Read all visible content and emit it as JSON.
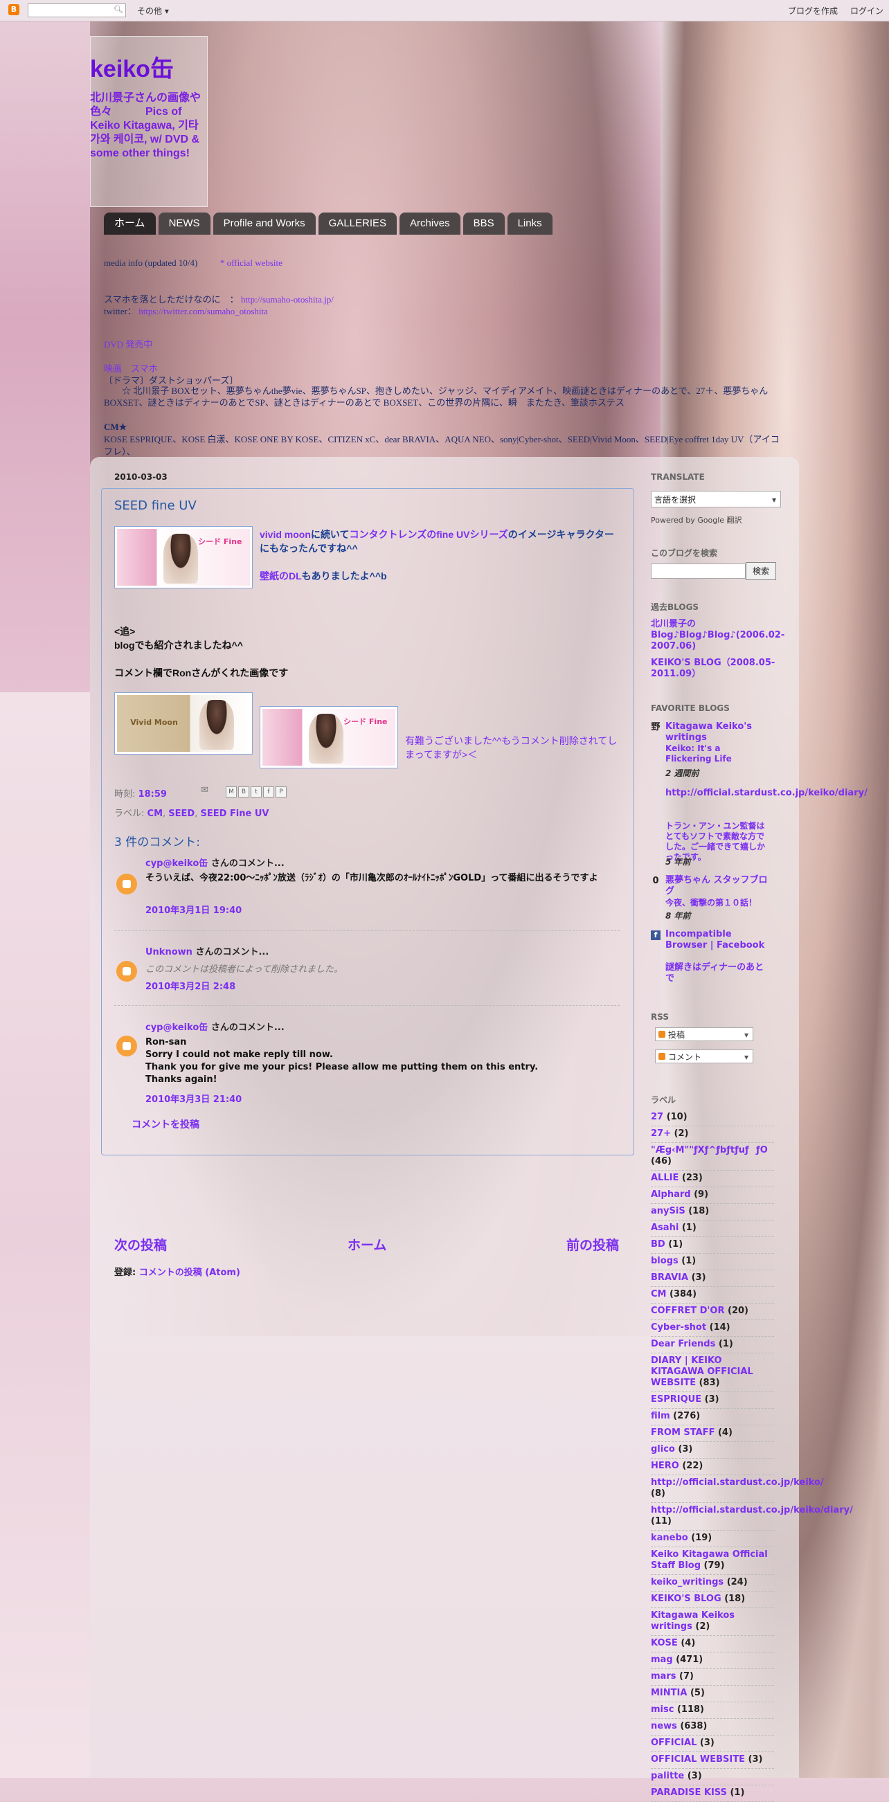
{
  "navbar": {
    "more": "その他",
    "create_blog": "ブログを作成",
    "login": "ログイン"
  },
  "header": {
    "title": "keiko缶",
    "description": "北川景子さんの画像や色々　　　Pics of Keiko Kitagawa, 기타가와 케이코, w/ DVD & some other things!"
  },
  "tabs": [
    {
      "label": "ホーム"
    },
    {
      "label": "NEWS"
    },
    {
      "label": "Profile and Works"
    },
    {
      "label": "GALLERIES"
    },
    {
      "label": "Archives"
    },
    {
      "label": "BBS"
    },
    {
      "label": "Links"
    }
  ],
  "header_links": {
    "line1": "media info (updated 10/4)",
    "official": "* official website",
    "line2_label": "スマホを落としただけなのに　：",
    "line2_url": "http://sumaho-otoshita.jp/",
    "line3_label": "twitter：",
    "line3_url": "https://twitter.com/sumaho_otoshita",
    "line4": "DVD 発売中",
    "line5": "映画　スマホ",
    "line6": "〔ドラマ〕ダストショッパーズ〕",
    "line7": "　　☆ 北川景子 BOXセット、悪夢ちゃんthe夢vie、悪夢ちゃんSP、抱きしめたい、ジャッジ、マイディアメイト、映画謎ときはディナーのあとで、27＋、悪夢ちゃん BOXSET、謎ときはディナーのあとでSP、謎ときはディナーのあとで BOXSET、この世界の片隅に、瞬　またたき、筆談ホステス",
    "cm_head": "CM★",
    "cm_list": "KOSE ESPRIQUE、KOSE 白漾、KOSE ONE BY KOSE、CITIZEN xC、dear BRAVIA、AQUA NEO、sony|Cyber-shot、SEED|Vivid Moon、SEED|Eye coffret 1day UV（アイコフレ）、"
  },
  "post": {
    "date": "2010-03-03",
    "title": "SEED fine UV",
    "p1_link1": "vivid moon",
    "p1_mid": "に続いて",
    "p1_link2": "コンタクトレンズのfine UVシリーズ",
    "p1_tail": "のイメージキャラクターにもなったんですね^^",
    "p1_link3": "壁紙のDL",
    "p1_tail2": "もありましたよ^^b",
    "p2a": "<追>",
    "p2b": "blogでも紹介されましたね^^",
    "p3": "コメント欄でRonさんがくれた画像です",
    "thanks": "有難うございました^^もうコメント削除されてしまってますが>＜",
    "thumb_label": "シード Fine",
    "thumb2_label": "Vivid Moon",
    "time_label": "時刻:",
    "time": "18:59",
    "labels_label": "ラベル:",
    "labels": [
      "CM",
      "SEED",
      "SEED Fine UV"
    ]
  },
  "comments": {
    "heading": "3 件のコメント:",
    "items": [
      {
        "author": "cyp@keiko缶",
        "suffix": " さんのコメント...",
        "body": "そういえば、今夜22:00～ﾆｯﾎﾟﾝ放送（ﾗｼﾞｵ）の「市川亀次郎のｵｰﾙﾅｲﾄﾆｯﾎﾟﾝGOLD」って番組に出るそうですよ",
        "time": "2010年3月1日 19:40"
      },
      {
        "author": "Unknown",
        "suffix": " さんのコメント...",
        "body": "このコメントは投稿者によって削除されました。",
        "time": "2010年3月2日 2:48"
      },
      {
        "author": "cyp@keiko缶",
        "suffix": " さんのコメント...",
        "body1": "Ron-san",
        "body2": "Sorry I could not make reply till now.",
        "body3": "Thank you for give me your pics! Please allow me putting them on this entry.",
        "body4": "Thanks again!",
        "time": "2010年3月3日 21:40"
      }
    ],
    "post_comment": "コメントを投稿"
  },
  "pager": {
    "newer": "次の投稿",
    "home": "ホーム",
    "older": "前の投稿"
  },
  "subscribe": {
    "label": "登録:",
    "link": "コメントの投稿 (Atom)"
  },
  "sidebar": {
    "translate_head": "TRANSLATE",
    "translate_select": "言語を選択",
    "powered": "Powered by Google 翻訳",
    "search_head": "このブログを検索",
    "search_btn": "検索",
    "past_head": "過去BLOGS",
    "past1": "北川景子のBlog♪Blog♪Blog♪(2006.02-2007.06)",
    "past2": "KEIKO'S BLOG（2008.05-2011.09）",
    "fav_head": "FAVORITE BLOGS",
    "favs": [
      {
        "icon": "野",
        "title": "Kitagawa Keiko's writings",
        "sub": "Keiko: It's a Flickering Life",
        "age": "2 週間前"
      },
      {
        "icon": "",
        "title": "http://official.stardust.co.jp/keiko/diary/",
        "sub": "トラン・アン・ユン監督はとてもソフトで素敵な方でした。ご一緒できて嬉しかったです。",
        "age": "5 年前"
      },
      {
        "icon": "0",
        "title": "悪夢ちゃん スタッフブログ",
        "sub": "今夜、衝撃の第１０話！",
        "age": "8 年前"
      },
      {
        "icon": "f",
        "title": "Incompatible Browser | Facebook",
        "sub": "",
        "age": ""
      },
      {
        "icon": "",
        "title": "謎解きはディナーのあとで",
        "sub": "",
        "age": ""
      }
    ],
    "rss_head": "RSS",
    "rss1": "投稿",
    "rss2": "コメント",
    "labels_head": "ラベル",
    "labels": [
      {
        "name": "27",
        "count": "(10)"
      },
      {
        "name": "27+",
        "count": "(2)"
      },
      {
        "name": "\"Æg‹M\"\"ƒXƒ^ƒbƒtƒuƒƒO",
        "count": "(46)"
      },
      {
        "name": "ALLIE",
        "count": "(23)"
      },
      {
        "name": "Alphard",
        "count": "(9)"
      },
      {
        "name": "anySiS",
        "count": "(18)"
      },
      {
        "name": "Asahi",
        "count": "(1)"
      },
      {
        "name": "BD",
        "count": "(1)"
      },
      {
        "name": "blogs",
        "count": "(1)"
      },
      {
        "name": "BRAVIA",
        "count": "(3)"
      },
      {
        "name": "CM",
        "count": "(384)"
      },
      {
        "name": "COFFRET D'OR",
        "count": "(20)"
      },
      {
        "name": "Cyber-shot",
        "count": "(14)"
      },
      {
        "name": "Dear Friends",
        "count": "(1)"
      },
      {
        "name": "DIARY | KEIKO KITAGAWA OFFICIAL WEBSITE",
        "count": "(83)"
      },
      {
        "name": "ESPRIQUE",
        "count": "(3)"
      },
      {
        "name": "film",
        "count": "(276)"
      },
      {
        "name": "FROM STAFF",
        "count": "(4)"
      },
      {
        "name": "glico",
        "count": "(3)"
      },
      {
        "name": "HERO",
        "count": "(22)"
      },
      {
        "name": "http://official.stardust.co.jp/keiko/",
        "count": "(8)"
      },
      {
        "name": "http://official.stardust.co.jp/keiko/diary/",
        "count": "(11)"
      },
      {
        "name": "kanebo",
        "count": "(19)"
      },
      {
        "name": "Keiko Kitagawa Official Staff Blog",
        "count": "(79)"
      },
      {
        "name": "keiko_writings",
        "count": "(24)"
      },
      {
        "name": "KEIKO'S BLOG",
        "count": "(18)"
      },
      {
        "name": "Kitagawa Keikos writings",
        "count": "(2)"
      },
      {
        "name": "KOSE",
        "count": "(4)"
      },
      {
        "name": "mag",
        "count": "(471)"
      },
      {
        "name": "mars",
        "count": "(7)"
      },
      {
        "name": "MINTIA",
        "count": "(5)"
      },
      {
        "name": "misc",
        "count": "(118)"
      },
      {
        "name": "news",
        "count": "(638)"
      },
      {
        "name": "OFFICIAL",
        "count": "(3)"
      },
      {
        "name": "OFFICIAL WEBSITE",
        "count": "(3)"
      },
      {
        "name": "palitte",
        "count": "(3)"
      },
      {
        "name": "PARADISE KISS",
        "count": "(1)"
      }
    ]
  }
}
